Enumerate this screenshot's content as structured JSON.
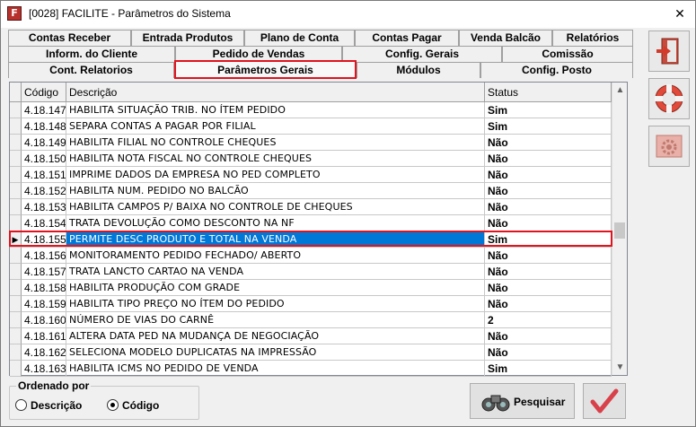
{
  "window": {
    "title": "[0028] FACILITE - Parâmetros do Sistema",
    "app_icon_letter": "F"
  },
  "tabs": {
    "row1": [
      {
        "label": "Contas Receber"
      },
      {
        "label": "Entrada Produtos"
      },
      {
        "label": "Plano de Conta"
      },
      {
        "label": "Contas Pagar"
      },
      {
        "label": "Venda Balcão"
      },
      {
        "label": "Relatórios"
      }
    ],
    "row2": [
      {
        "label": "Inform. do Cliente"
      },
      {
        "label": "Pedido de Vendas"
      },
      {
        "label": "Config. Gerais"
      },
      {
        "label": "Comissão"
      }
    ],
    "row3": [
      {
        "label": "Cont. Relatorios"
      },
      {
        "label": "Parâmetros Gerais"
      },
      {
        "label": "Módulos"
      },
      {
        "label": "Config. Posto"
      }
    ],
    "active": "Parâmetros Gerais"
  },
  "grid": {
    "columns": [
      "Código",
      "Descrição",
      "Status"
    ],
    "rows": [
      {
        "code": "4.18.147",
        "desc": "HABILITA SITUAÇÃO TRIB. NO ÍTEM PEDIDO",
        "status": "Sim"
      },
      {
        "code": "4.18.148",
        "desc": "SEPARA CONTAS A PAGAR POR FILIAL",
        "status": "Sim"
      },
      {
        "code": "4.18.149",
        "desc": "HABILITA FILIAL NO CONTROLE CHEQUES",
        "status": "Não"
      },
      {
        "code": "4.18.150",
        "desc": "HABILITA NOTA FISCAL NO CONTROLE CHEQUES",
        "status": "Não"
      },
      {
        "code": "4.18.151",
        "desc": "IMPRIME DADOS DA EMPRESA NO PED COMPLETO",
        "status": "Não"
      },
      {
        "code": "4.18.152",
        "desc": "HABILITA NUM. PEDIDO NO BALCÃO",
        "status": "Não"
      },
      {
        "code": "4.18.153",
        "desc": "HABILITA CAMPOS P/ BAIXA NO CONTROLE DE CHEQUES",
        "status": "Não"
      },
      {
        "code": "4.18.154",
        "desc": "TRATA DEVOLUÇÃO COMO DESCONTO NA NF",
        "status": "Não"
      },
      {
        "code": "4.18.155",
        "desc": "PERMITE DESC PRODUTO E TOTAL NA VENDA",
        "status": "Sim",
        "selected": true
      },
      {
        "code": "4.18.156",
        "desc": "MONITORAMENTO PEDIDO FECHADO/ ABERTO",
        "status": "Não"
      },
      {
        "code": "4.18.157",
        "desc": "TRATA LANCTO CARTAO NA VENDA",
        "status": "Não"
      },
      {
        "code": "4.18.158",
        "desc": "HABILITA PRODUÇÃO COM GRADE",
        "status": "Não"
      },
      {
        "code": "4.18.159",
        "desc": "HABILITA TIPO PREÇO NO ÍTEM DO PEDIDO",
        "status": "Não"
      },
      {
        "code": "4.18.160",
        "desc": "NÚMERO DE VIAS DO CARNÊ",
        "status": "2"
      },
      {
        "code": "4.18.161",
        "desc": "ALTERA DATA PED NA MUDANÇA DE NEGOCIAÇÃO",
        "status": "Não"
      },
      {
        "code": "4.18.162",
        "desc": "SELECIONA MODELO DUPLICATAS NA IMPRESSÃO",
        "status": "Não"
      },
      {
        "code": "4.18.163",
        "desc": "HABILITA ICMS NO PEDIDO DE VENDA",
        "status": "Sim"
      }
    ]
  },
  "order": {
    "legend": "Ordenado por",
    "options": [
      "Descrição",
      "Código"
    ],
    "selected": "Código"
  },
  "buttons": {
    "search_label": "Pesquisar"
  },
  "side_buttons": [
    "exit-icon",
    "lifebuoy-icon",
    "settings-icon"
  ],
  "colors": {
    "selection": "#0078d7",
    "highlight_frame": "#e0141e"
  }
}
